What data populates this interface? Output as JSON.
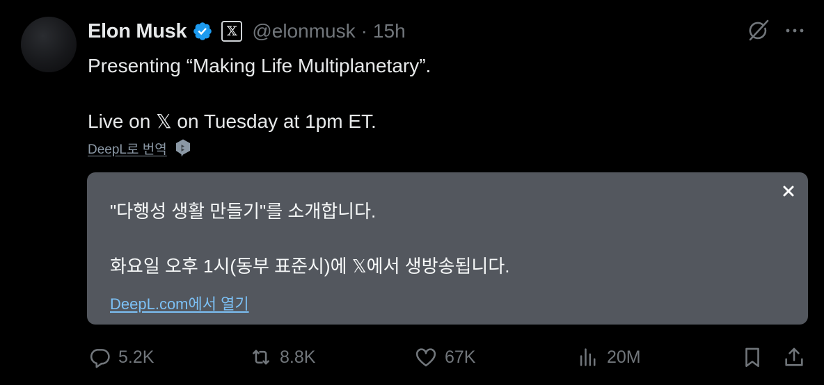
{
  "tweet": {
    "author_name": "Elon Musk",
    "affiliation_badge": "𝕏",
    "handle": "@elonmusk",
    "separator": "·",
    "time": "15h",
    "line1": "Presenting “Making Life Multiplanetary”.",
    "line2": "Live on 𝕏 on Tuesday at 1pm ET."
  },
  "translate": {
    "link_label": "DeepL로 번역",
    "line1": "\"다행성 생활 만들기\"를 소개합니다.",
    "line2": "화요일 오후 1시(동부 표준시)에 𝕏에서 생방송됩니다.",
    "open_link": "DeepL.com에서 열기"
  },
  "actions": {
    "replies": "5.2K",
    "reposts": "8.8K",
    "likes": "67K",
    "views": "20M"
  },
  "colors": {
    "background": "#000000",
    "verified": "#1d9bf0",
    "muted": "#71767b",
    "translation_box": "#53575e",
    "link": "#7cc0f5"
  },
  "icons": [
    "avatar",
    "verified-badge-icon",
    "grok-icon",
    "more-icon",
    "deepl-icon",
    "close-icon",
    "reply-icon",
    "repost-icon",
    "like-icon",
    "views-icon",
    "bookmark-icon",
    "share-icon"
  ]
}
